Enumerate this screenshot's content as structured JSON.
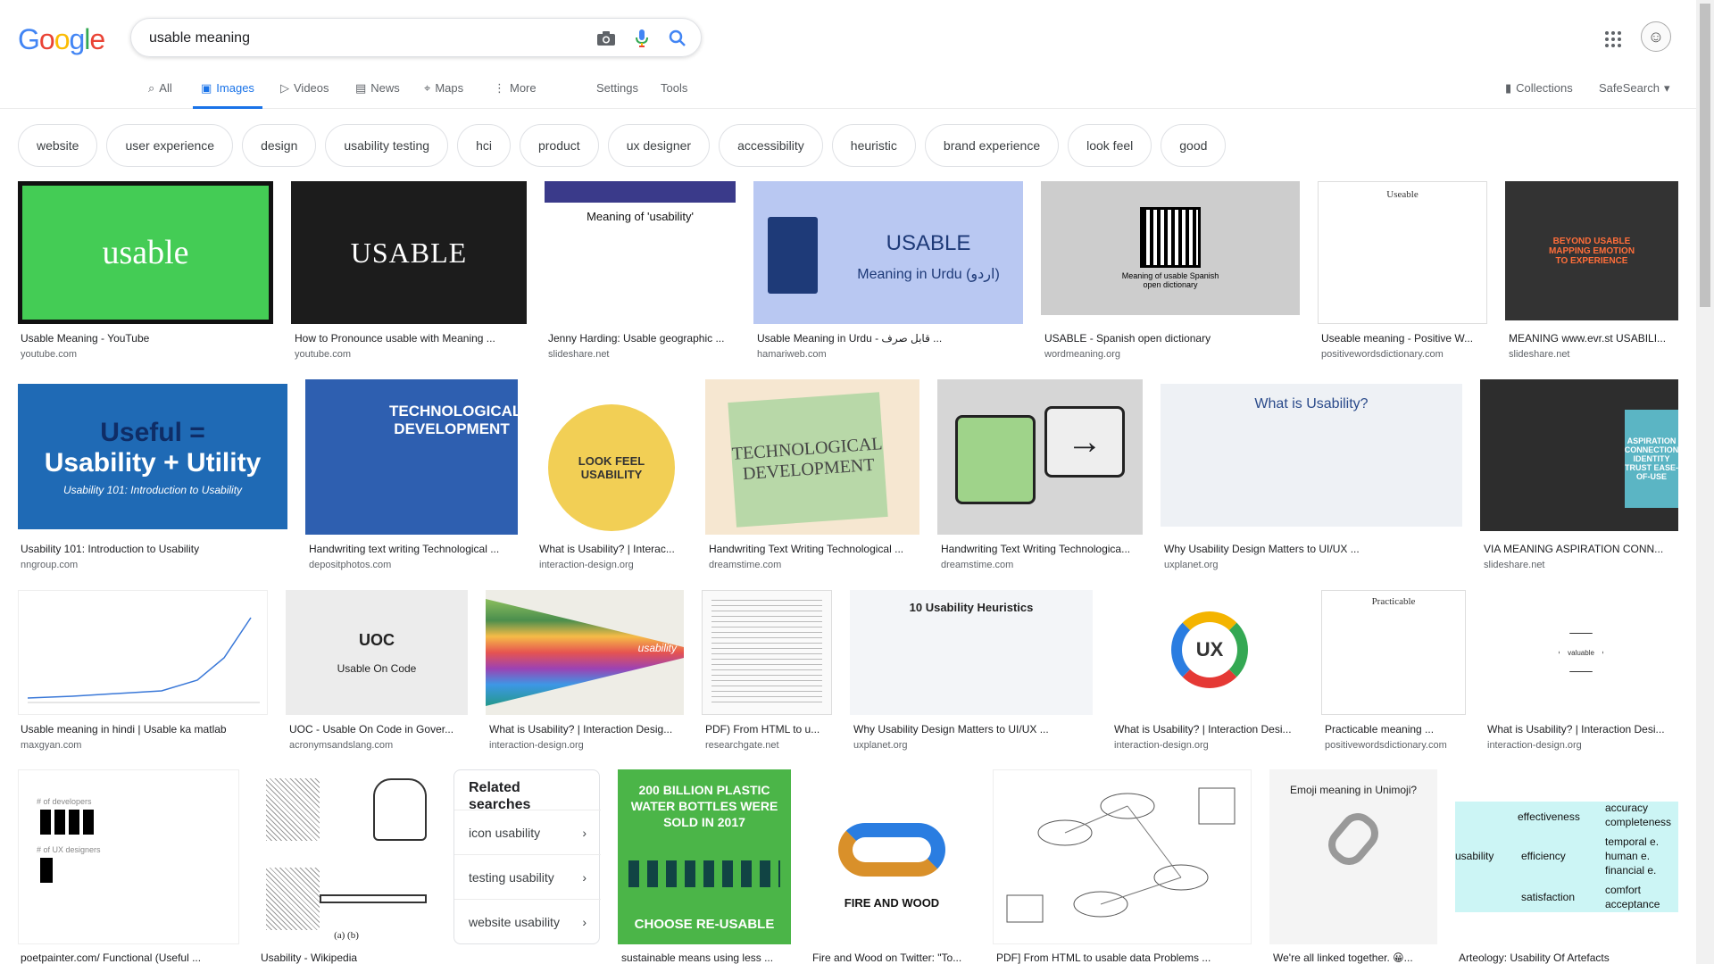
{
  "logo": "Google",
  "search": {
    "value": "usable meaning",
    "placeholder": ""
  },
  "nav": {
    "all": "All",
    "images": "Images",
    "videos": "Videos",
    "news": "News",
    "maps": "Maps",
    "more": "More",
    "settings": "Settings",
    "tools": "Tools",
    "collections": "Collections",
    "safesearch": "SafeSearch"
  },
  "chips": [
    "website",
    "user experience",
    "design",
    "usability testing",
    "hci",
    "product",
    "ux designer",
    "accessibility",
    "heuristic",
    "brand experience",
    "look feel",
    "good"
  ],
  "results": {
    "r1": [
      {
        "title": "Usable Meaning - YouTube",
        "source": "youtube.com",
        "text": "usable"
      },
      {
        "title": "How to Pronounce usable with Meaning ...",
        "source": "youtube.com",
        "text": "USABLE"
      },
      {
        "title": "Jenny Harding: Usable geographic ...",
        "source": "slideshare.net",
        "text": "Meaning of 'usability'"
      },
      {
        "title": "Usable Meaning in Urdu - قابل صرف ...",
        "source": "hamariweb.com",
        "text": "USABLE",
        "text2": "Meaning in Urdu (اردو)"
      },
      {
        "title": "USABLE - Spanish open dictionary",
        "source": "wordmeaning.org",
        "text": "Meaning of usable Spanish open dictionary"
      },
      {
        "title": "Useable meaning - Positive W...",
        "source": "positivewordsdictionary.com",
        "text": "Useable"
      },
      {
        "title": "MEANING www.evr.st USABILI...",
        "source": "slideshare.net",
        "text": "BEYOND USABLE MAPPING EMOTION TO EXPERIENCE"
      }
    ],
    "r2": [
      {
        "title": "Usability 101: Introduction to Usability",
        "source": "nngroup.com",
        "text": "Useful =",
        "text2": "Usability + Utility",
        "text3": "Usability 101: Introduction to Usability"
      },
      {
        "title": "Handwriting text writing Technological ...",
        "source": "depositphotos.com",
        "text": "TECHNOLOGICAL DEVELOPMENT"
      },
      {
        "title": "What is Usability? | Interac...",
        "source": "interaction-design.org",
        "text": "LOOK FEEL USABILITY"
      },
      {
        "title": "Handwriting Text Writing Technological ...",
        "source": "dreamstime.com",
        "text": "TECHNOLOGICAL DEVELOPMENT"
      },
      {
        "title": "Handwriting Text Writing Technologica...",
        "source": "dreamstime.com",
        "text": "→"
      },
      {
        "title": "Why Usability Design Matters to UI/UX ...",
        "source": "uxplanet.org",
        "text": "What is Usability?"
      },
      {
        "title": "VIA MEANING ASPIRATION CONN...",
        "source": "slideshare.net",
        "text": "ASPIRATION CONNECTION IDENTITY TRUST EASE-OF-USE"
      }
    ],
    "r3": [
      {
        "title": "Usable meaning in hindi | Usable ka matlab",
        "source": "maxgyan.com",
        "text": ""
      },
      {
        "title": "UOC - Usable On Code in Gover...",
        "source": "acronymsandslang.com",
        "text": "UOC",
        "text2": "Usable On Code"
      },
      {
        "title": "What is Usability? | Interaction Desig...",
        "source": "interaction-design.org",
        "text": "usability"
      },
      {
        "title": "PDF) From HTML to u...",
        "source": "researchgate.net",
        "text": ""
      },
      {
        "title": "Why Usability Design Matters to UI/UX ...",
        "source": "uxplanet.org",
        "text": "10 Usability Heuristics"
      },
      {
        "title": "What is Usability? | Interaction Desi...",
        "source": "interaction-design.org",
        "text": "UX"
      },
      {
        "title": "Practicable meaning ...",
        "source": "positivewordsdictionary.com",
        "text": "Practicable"
      },
      {
        "title": "What is Usability? | Interaction Desi...",
        "source": "interaction-design.org",
        "text": "valuable"
      }
    ],
    "r4": [
      {
        "title": "poetpainter.com/ Functional (Useful ...",
        "source": "",
        "text": "# of developers",
        "text2": "# of UX designers"
      },
      {
        "title": "Usability - Wikipedia",
        "source": "",
        "text": "(a) (b)"
      },
      {
        "title": "sustainable means using less ...",
        "source": "",
        "text": "200 BILLION PLASTIC WATER BOTTLES WERE SOLD IN 2017",
        "text2": "CHOOSE RE-USABLE"
      },
      {
        "title": "Fire and Wood on Twitter: \"To...",
        "source": "",
        "text": "FIRE AND WOOD"
      },
      {
        "title": "PDF] From HTML to usable data Problems ...",
        "source": "",
        "text": ""
      },
      {
        "title": "We're all linked together. 😀...",
        "source": "",
        "text": "Emoji meaning in Unimoji?"
      },
      {
        "title": "Arteology: Usability Of Artefacts",
        "source": "",
        "text": "usability",
        "labels": [
          "effectiveness",
          "efficiency",
          "satisfaction",
          "accuracy",
          "completeness",
          "temporal e.",
          "human e.",
          "financial e.",
          "comfort",
          "acceptance"
        ]
      }
    ]
  },
  "related": {
    "title": "Related searches",
    "items": [
      "icon usability",
      "testing usability",
      "website usability"
    ]
  }
}
